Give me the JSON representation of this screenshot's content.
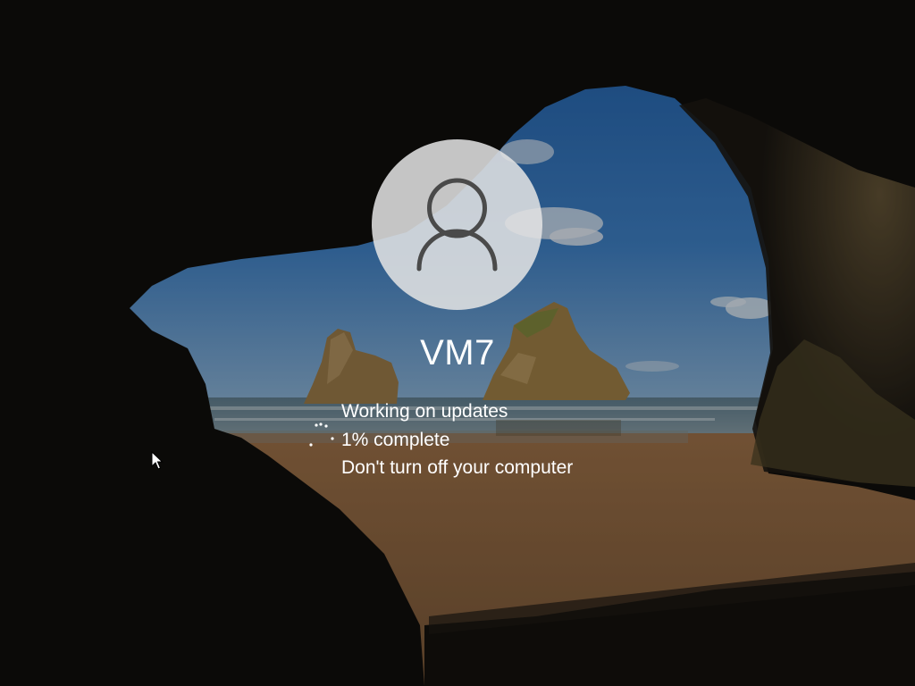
{
  "lock_screen": {
    "username": "VM7",
    "avatar_icon": "user-silhouette-icon",
    "status": {
      "title": "Working on updates",
      "progress_text": "1% complete",
      "progress_percent": 1,
      "warning": "Don't turn off your computer"
    },
    "spinner_icon": "loading-dots-icon",
    "cursor_icon": "mouse-pointer-icon"
  },
  "colors": {
    "text": "#ffffff",
    "avatar_bg": "#e4e4e4",
    "avatar_icon": "#4a4a4a",
    "sky": "#2f6fb8",
    "sand": "#b07a48",
    "cave": "#141210"
  }
}
